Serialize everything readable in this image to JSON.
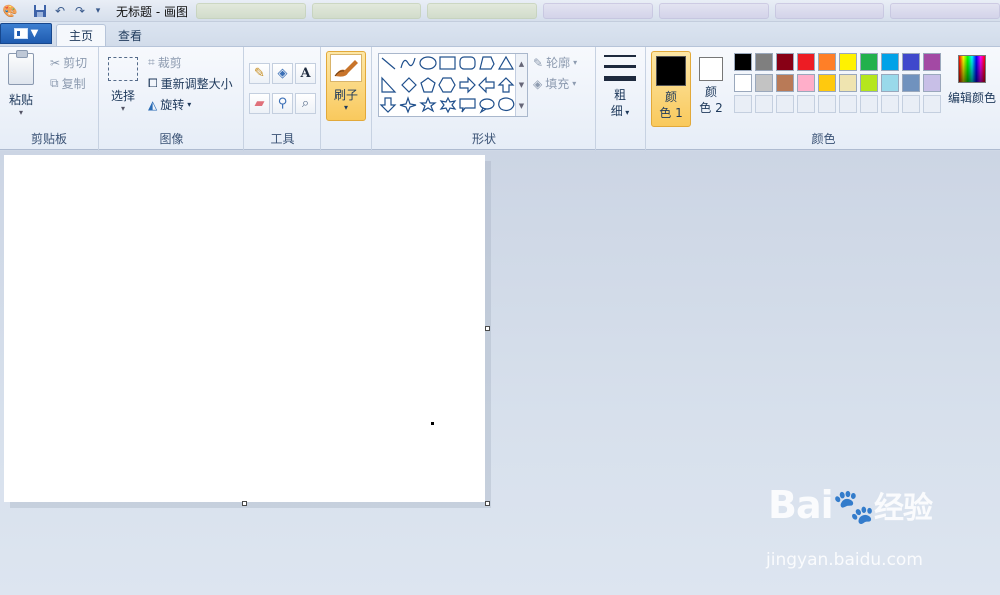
{
  "titlebar": {
    "title": "无标题 - 画图"
  },
  "tabs": [
    {
      "label": "主页"
    },
    {
      "label": "查看"
    }
  ],
  "clipboard": {
    "paste": "粘贴",
    "cut": "剪切",
    "copy": "复制",
    "group": "剪贴板"
  },
  "image": {
    "select": "选择",
    "crop": "裁剪",
    "resize": "重新调整大小",
    "rotate": "旋转",
    "group": "图像"
  },
  "tools": {
    "group": "工具",
    "text_glyph": "A"
  },
  "brush": {
    "label": "刷子"
  },
  "shapes": {
    "outline": "轮廓",
    "fill": "填充",
    "group": "形状"
  },
  "size": {
    "label1": "粗",
    "label2": "细"
  },
  "colors": {
    "color1_label_a": "颜",
    "color1_label_b": "色 1",
    "color2_label_a": "颜",
    "color2_label_b": "色 2",
    "edit_colors": "编辑颜色",
    "group": "颜色",
    "color1": "#000000",
    "color2": "#ffffff",
    "palette_row1": [
      "#000000",
      "#7f7f7f",
      "#880015",
      "#ed1c24",
      "#ff7f27",
      "#fff200",
      "#22b14c",
      "#00a2e8",
      "#3f48cc",
      "#a349a4"
    ],
    "palette_row2": [
      "#ffffff",
      "#c3c3c3",
      "#b97a57",
      "#ffaec9",
      "#ffc90e",
      "#efe4b0",
      "#b5e61d",
      "#99d9ea",
      "#7092be",
      "#c8bfe7"
    ]
  },
  "watermark": {
    "brand": "Bai",
    "brand2": "经验",
    "url": "jingyan.baidu.com"
  }
}
